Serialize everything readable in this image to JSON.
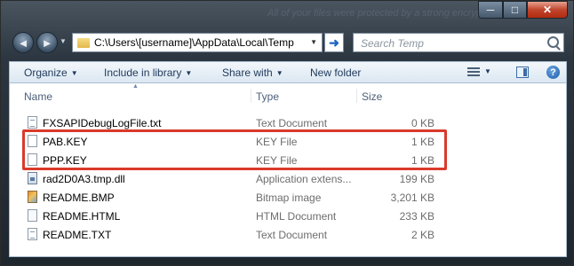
{
  "background_text": "All of your files were protected by a strong encryption",
  "window": {
    "controls": {
      "minimize": "─",
      "maximize": "□",
      "close": "✕"
    }
  },
  "nav": {
    "back_icon": "◄",
    "forward_icon": "►",
    "dropdown_icon": "▼",
    "address": "C:\\Users\\[username]\\AppData\\Local\\Temp",
    "go_icon": "➜",
    "search_placeholder": "Search Temp"
  },
  "toolbar": {
    "organize": "Organize",
    "include_in_library": "Include in library",
    "share_with": "Share with",
    "new_folder": "New folder",
    "help": "?"
  },
  "columns": {
    "name": "Name",
    "type": "Type",
    "size": "Size"
  },
  "files": [
    {
      "name": "FXSAPIDebugLogFile.txt",
      "type": "Text Document",
      "size": "0 KB",
      "icon": "text-file-icon"
    },
    {
      "name": "PAB.KEY",
      "type": "KEY File",
      "size": "1 KB",
      "icon": "blank-file-icon"
    },
    {
      "name": "PPP.KEY",
      "type": "KEY File",
      "size": "1 KB",
      "icon": "blank-file-icon"
    },
    {
      "name": "rad2D0A3.tmp.dll",
      "type": "Application extens...",
      "size": "199 KB",
      "icon": "dll-file-icon"
    },
    {
      "name": "README.BMP",
      "type": "Bitmap image",
      "size": "3,201 KB",
      "icon": "bitmap-file-icon"
    },
    {
      "name": "README.HTML",
      "type": "HTML Document",
      "size": "233 KB",
      "icon": "html-file-icon"
    },
    {
      "name": "README.TXT",
      "type": "Text Document",
      "size": "2 KB",
      "icon": "text-file-icon"
    }
  ],
  "highlight_color": "#d93a2b"
}
